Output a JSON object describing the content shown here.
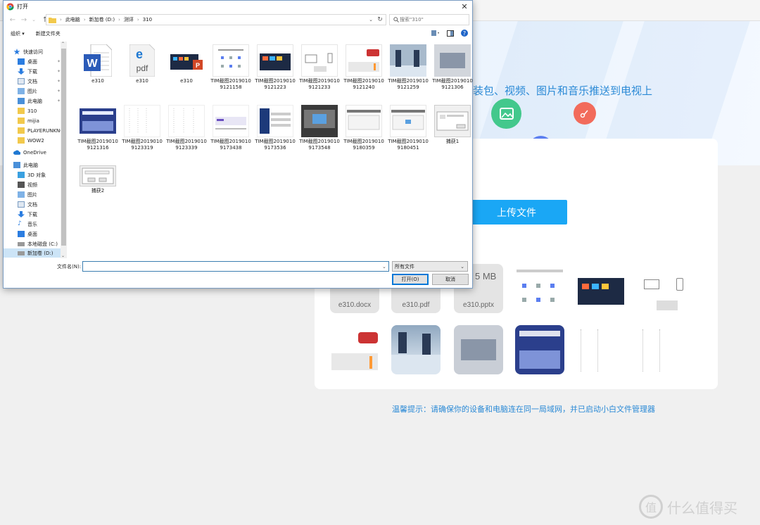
{
  "dialog": {
    "title": "打开",
    "breadcrumb": [
      "此电脑",
      "新加卷 (D:)",
      "测评",
      "310"
    ],
    "search_placeholder": "搜索\"310\"",
    "toolbar": {
      "organize": "组织 ▾",
      "new_folder": "新建文件夹"
    },
    "nav": {
      "quick_access": "快速访问",
      "quick_items": [
        "桌面",
        "下载",
        "文档",
        "图片",
        "此电脑",
        "310",
        "mijia",
        "PLAYERUNKNOWN",
        "WOW2"
      ],
      "onedrive": "OneDrive",
      "this_pc": "此电脑",
      "pc_items": [
        "3D 对象",
        "视频",
        "图片",
        "文档",
        "下载",
        "音乐",
        "桌面",
        "本地磁盘 (C:)",
        "新加卷 (D:)"
      ]
    },
    "files": [
      {
        "name": "e310",
        "type": "word"
      },
      {
        "name": "e310",
        "type": "pdf"
      },
      {
        "name": "e310",
        "type": "ppt"
      },
      {
        "name": "TIM截图20190109121158",
        "type": "shot"
      },
      {
        "name": "TIM截图20190109121223",
        "type": "shot"
      },
      {
        "name": "TIM截图20190109121233",
        "type": "shot"
      },
      {
        "name": "TIM截图20190109121240",
        "type": "shot"
      },
      {
        "name": "TIM截图20190109121259",
        "type": "shot"
      },
      {
        "name": "TIM截图20190109121306",
        "type": "shot"
      },
      {
        "name": "TIM截图20190109121316",
        "type": "shot"
      },
      {
        "name": "TIM截图20190109123319",
        "type": "shot"
      },
      {
        "name": "TIM截图20190109123339",
        "type": "shot"
      },
      {
        "name": "TIM截图20190109173438",
        "type": "shot"
      },
      {
        "name": "TIM截图20190109173536",
        "type": "shot"
      },
      {
        "name": "TIM截图20190109173548",
        "type": "shot"
      },
      {
        "name": "TIM截图20190109180359",
        "type": "shot"
      },
      {
        "name": "TIM截图20190109180451",
        "type": "shot"
      },
      {
        "name": "捕获1",
        "type": "cap"
      },
      {
        "name": "捕获2",
        "type": "cap"
      }
    ],
    "filename_label": "文件名(N):",
    "filename_value": "",
    "filetype_value": "所有文件",
    "open_label": "打开(O)",
    "cancel_label": "取消"
  },
  "background": {
    "banner_text": "装包、视频、图片和音乐推送到电视上",
    "upload_label": "上传文件",
    "file_labels": [
      "e310.docx",
      "e310.pdf",
      "e310.pptx"
    ],
    "pptx_size_partial": "5 MB",
    "tip": "温馨提示：请确保你的设备和电脑连在同一局域网，并已启动小白文件管理器",
    "watermark": "什么值得买",
    "colors": {
      "accent": "#1aa7f5",
      "tip_blue": "#2b8ad6"
    }
  }
}
